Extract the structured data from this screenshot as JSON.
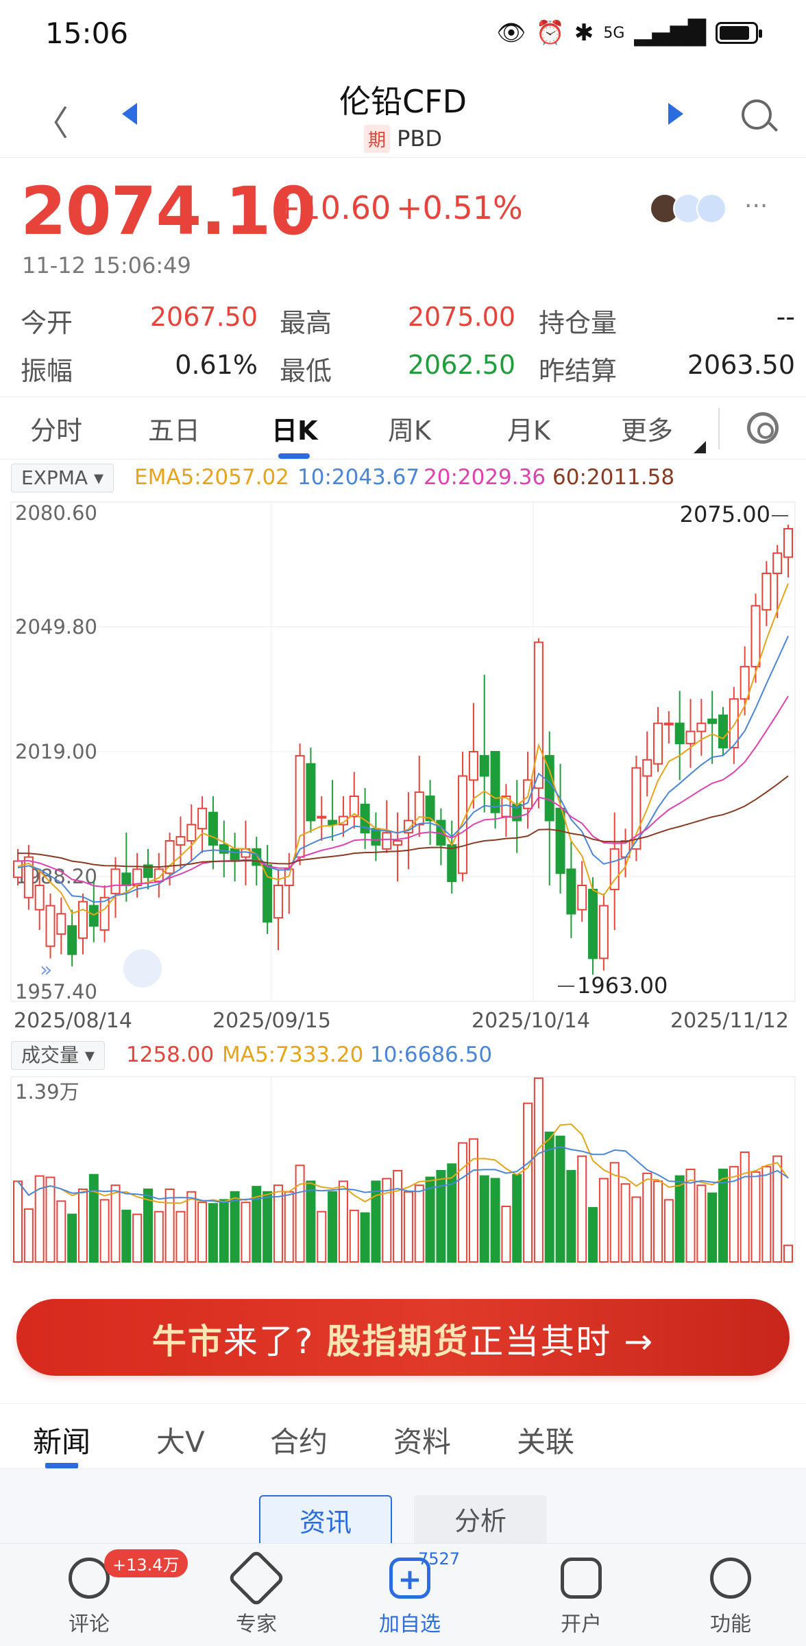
{
  "status": {
    "time": "15:06",
    "network": "5G",
    "battery_level": 0.85
  },
  "nav": {
    "title": "伦铅CFD",
    "tag": "期",
    "code": "PBD"
  },
  "quote": {
    "price": "2074.10",
    "change": "+10.60",
    "change_pct": "+0.51%",
    "timestamp": "11-12 15:06:49"
  },
  "stats": {
    "open_label": "今开",
    "open": "2067.50",
    "high_label": "最高",
    "high": "2075.00",
    "oi_label": "持仓量",
    "oi": "--",
    "amp_label": "振幅",
    "amp": "0.61%",
    "low_label": "最低",
    "low": "2062.50",
    "settle_label": "昨结算",
    "settle": "2063.50"
  },
  "ktabs": [
    "分时",
    "五日",
    "日K",
    "周K",
    "月K",
    "更多"
  ],
  "indicators": {
    "dropdown": "EXPMA",
    "ema5": "EMA5:2057.02",
    "ema10": "10:2043.67",
    "ema20": "20:2029.36",
    "ema60": "60:2011.58",
    "ema5_color": "#e8a417",
    "ema10_color": "#4a86d8",
    "ema20_color": "#e040b0",
    "ema60_color": "#8a3a20"
  },
  "chart_data": {
    "type": "candlestick",
    "y_ticks": [
      "2080.60",
      "2049.80",
      "2019.00",
      "1988.20",
      "1957.40"
    ],
    "ylim": [
      1957.4,
      2080.6
    ],
    "x_ticks": [
      "2025/08/14",
      "2025/09/15",
      "2025/10/14",
      "2025/11/12"
    ],
    "max_label": "2075.00",
    "min_label": "1963.00",
    "candles": [
      [
        1988,
        1992,
        1986,
        1995
      ],
      [
        1983,
        1993,
        1980,
        1996
      ],
      [
        1980,
        1986,
        1975,
        1990
      ],
      [
        1971,
        1981,
        1968,
        1984
      ],
      [
        1974,
        1979,
        1969,
        1983
      ],
      [
        1976,
        1969,
        1966,
        1980
      ],
      [
        1973,
        1982,
        1969,
        1984
      ],
      [
        1981,
        1976,
        1972,
        1987
      ],
      [
        1975,
        1983,
        1972,
        1986
      ],
      [
        1984,
        1990,
        1978,
        1993
      ],
      [
        1989,
        1986,
        1982,
        1999
      ],
      [
        1986,
        1990,
        1983,
        1994
      ],
      [
        1991,
        1988,
        1985,
        1995
      ],
      [
        1987,
        1990,
        1983,
        1994
      ],
      [
        1989,
        1997,
        1986,
        1999
      ],
      [
        1996,
        1998,
        1990,
        2003
      ],
      [
        1997,
        2001,
        1992,
        2006
      ],
      [
        2000,
        2005,
        1994,
        2008
      ],
      [
        2004,
        1996,
        1990,
        2008
      ],
      [
        1996,
        1994,
        1988,
        2002
      ],
      [
        1995,
        1992,
        1987,
        1999
      ],
      [
        1993,
        1995,
        1986,
        2002
      ],
      [
        1995,
        1991,
        1986,
        1998
      ],
      [
        1991,
        1977,
        1974,
        1996
      ],
      [
        1978,
        1986,
        1970,
        1990
      ],
      [
        1986,
        1990,
        1979,
        1994
      ],
      [
        1993,
        2018,
        1991,
        2021
      ],
      [
        2016,
        2002,
        1999,
        2020
      ],
      [
        2003,
        2003,
        1997,
        2008
      ],
      [
        2002,
        2001,
        1997,
        2012
      ],
      [
        2001,
        2003,
        1998,
        2008
      ],
      [
        2003,
        2008,
        2000,
        2014
      ],
      [
        2006,
        1999,
        1995,
        2010
      ],
      [
        2000,
        1996,
        1992,
        2004
      ],
      [
        1995,
        1999,
        1994,
        2007
      ],
      [
        1996,
        1997,
        1987,
        2004
      ],
      [
        1999,
        2002,
        1990,
        2009
      ],
      [
        2001,
        2009,
        1998,
        2018
      ],
      [
        2008,
        2002,
        1996,
        2012
      ],
      [
        2002,
        1996,
        1991,
        2005
      ],
      [
        1996,
        1987,
        1984,
        2002
      ],
      [
        1989,
        2013,
        1987,
        2019
      ],
      [
        2012,
        2019,
        2005,
        2031
      ],
      [
        2018,
        2013,
        2004,
        2038
      ],
      [
        2019,
        2004,
        2000,
        2019
      ],
      [
        2003,
        2008,
        1998,
        2011
      ],
      [
        2006,
        2002,
        1994,
        2012
      ],
      [
        2005,
        2012,
        2000,
        2019
      ],
      [
        2010,
        2046,
        2005,
        2047
      ],
      [
        2018,
        2002,
        1986,
        2024
      ],
      [
        2005,
        1989,
        1984,
        2016
      ],
      [
        1990,
        1979,
        1973,
        1997
      ],
      [
        1980,
        1986,
        1977,
        1992
      ],
      [
        1985,
        1968,
        1964,
        1988
      ],
      [
        1968,
        1981,
        1965,
        1984
      ],
      [
        1985,
        1995,
        1975,
        2004
      ],
      [
        1993,
        1997,
        1988,
        2000
      ],
      [
        1995,
        2015,
        1992,
        2018
      ],
      [
        2013,
        2017,
        2008,
        2024
      ],
      [
        2016,
        2026,
        2014,
        2030
      ],
      [
        2026,
        2026,
        2021,
        2029
      ],
      [
        2026,
        2021,
        2012,
        2034
      ],
      [
        2021,
        2024,
        2015,
        2032
      ],
      [
        2024,
        2026,
        2018,
        2032
      ],
      [
        2027,
        2026,
        2016,
        2034
      ],
      [
        2028,
        2020,
        2018,
        2030
      ],
      [
        2020,
        2032,
        2016,
        2035
      ],
      [
        2032,
        2040,
        2028,
        2045
      ],
      [
        2040,
        2055,
        2036,
        2058
      ],
      [
        2054,
        2063,
        2050,
        2066
      ],
      [
        2063,
        2068,
        2052,
        2070
      ],
      [
        2067,
        2074,
        2062,
        2075
      ]
    ]
  },
  "volume": {
    "dropdown": "成交量",
    "vol": "1258.00",
    "ma5": "MA5:7333.20",
    "ma10": "10:6686.50",
    "max_label": "1.39万",
    "values": [
      6100,
      4000,
      6500,
      6400,
      4600,
      3600,
      5500,
      6600,
      4700,
      5800,
      3900,
      3600,
      5500,
      3800,
      5500,
      3800,
      5300,
      4500,
      4400,
      4700,
      5300,
      4500,
      5700,
      5300,
      5800,
      5300,
      7300,
      6100,
      3800,
      5300,
      6100,
      3900,
      3700,
      6100,
      6300,
      6900,
      5300,
      5800,
      6400,
      6900,
      7400,
      9000,
      9300,
      6500,
      6300,
      4200,
      6600,
      12000,
      13900,
      9800,
      9500,
      6900,
      8000,
      4100,
      6300,
      7500,
      5900,
      4900,
      6700,
      6100,
      4700,
      6500,
      7000,
      5800,
      5200,
      7000,
      7200,
      8300,
      6800,
      7200,
      8000,
      1258
    ]
  },
  "banner": {
    "part1": "牛市",
    "part2": "来了? ",
    "part3": "股指期货",
    "part4": "正当其时 →"
  },
  "news_tabs": [
    "新闻",
    "大V",
    "合约",
    "资料",
    "关联"
  ],
  "sub_tabs": [
    "资讯",
    "分析"
  ],
  "bottom_nav": [
    {
      "label": "评论",
      "badge": "+13.4万"
    },
    {
      "label": "专家"
    },
    {
      "label": "加自选",
      "count": "7527"
    },
    {
      "label": "开户"
    },
    {
      "label": "功能"
    }
  ],
  "colors": {
    "up": "#e8433a",
    "down": "#1e9e3a",
    "accent": "#2b6ce0"
  }
}
